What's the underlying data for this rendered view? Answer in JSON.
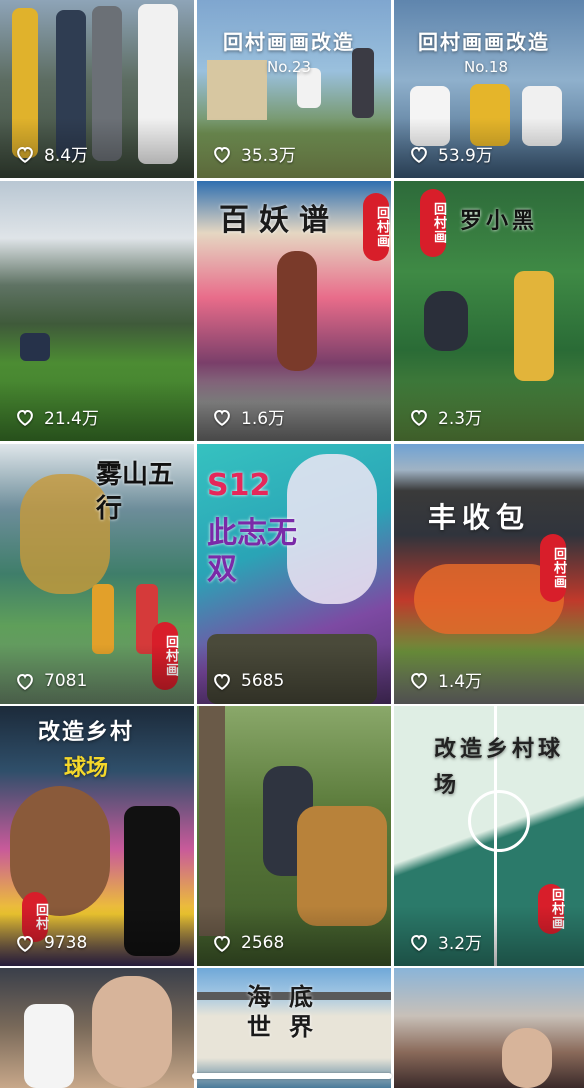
{
  "videos": [
    {
      "likes": "8.4万",
      "title": "",
      "subtitle": ""
    },
    {
      "likes": "35.3万",
      "title": "回村画画改造",
      "subtitle": "No.23"
    },
    {
      "likes": "53.9万",
      "title": "回村画画改造",
      "subtitle": "No.18"
    },
    {
      "likes": "21.4万",
      "title": "",
      "subtitle": ""
    },
    {
      "likes": "1.6万",
      "title": "百妖谱",
      "subtitle": "",
      "stamp": "回村画"
    },
    {
      "likes": "2.3万",
      "title": "罗小黑",
      "subtitle": "",
      "stamp": "回村画"
    },
    {
      "likes": "7081",
      "title": "雾山五行",
      "subtitle": "",
      "stamp": "回村画"
    },
    {
      "likes": "5685",
      "title": "S12",
      "subtitle": "此志无双"
    },
    {
      "likes": "1.4万",
      "title": "丰收包",
      "subtitle": "",
      "stamp": "回村画"
    },
    {
      "likes": "9738",
      "title": "改造乡村",
      "subtitle": "球场",
      "stamp": "回村"
    },
    {
      "likes": "2568",
      "title": "",
      "subtitle": ""
    },
    {
      "likes": "3.2万",
      "title": "改造乡村球场",
      "subtitle": "",
      "stamp": "回村画"
    },
    {
      "likes": "",
      "title": "",
      "subtitle": ""
    },
    {
      "likes": "",
      "title": "海底世界",
      "subtitle": ""
    },
    {
      "likes": "",
      "title": "",
      "subtitle": ""
    }
  ],
  "icons": {
    "like": "heart-outline-icon"
  },
  "colors": {
    "text": "#ffffff",
    "stamp": "#d81e2a",
    "background": "#ffffff"
  }
}
